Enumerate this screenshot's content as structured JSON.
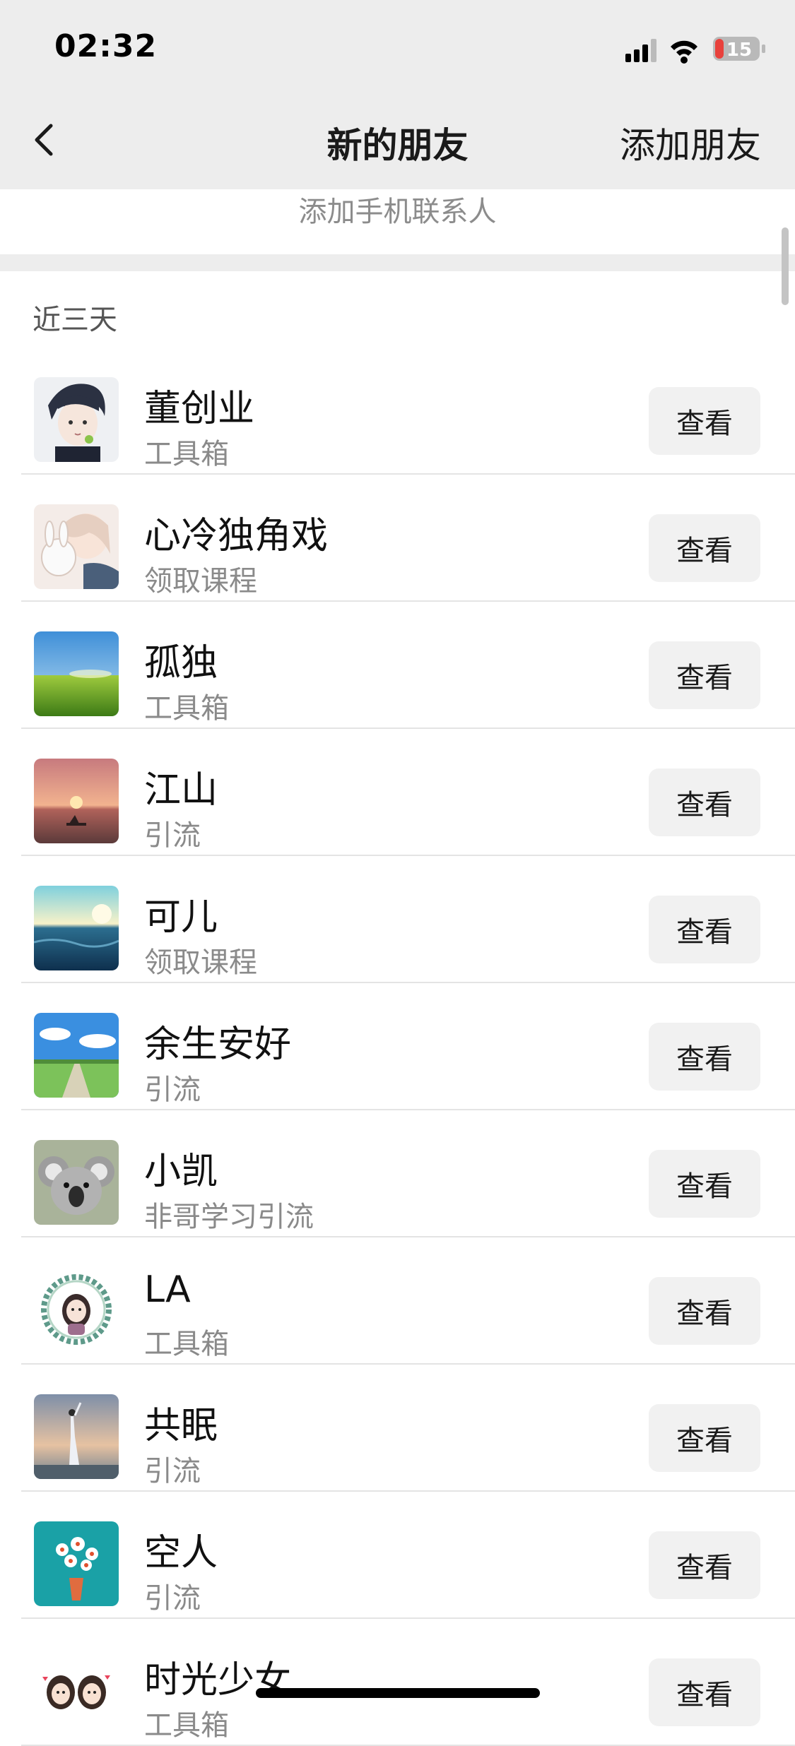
{
  "status_bar": {
    "time": "02:32",
    "battery": "15",
    "icons": [
      "signal-icon",
      "wifi-icon",
      "battery-icon"
    ]
  },
  "nav": {
    "back_icon": "chevron-left-icon",
    "title": "新的朋友",
    "add_friend": "添加朋友"
  },
  "phone_contacts": "添加手机联系人",
  "section_title": "近三天",
  "view_label": "查看",
  "friends": [
    {
      "name": "董创业",
      "source": "工具箱",
      "avatar": "anime-boy-avatar"
    },
    {
      "name": "心冷独角戏",
      "source": "领取课程",
      "avatar": "anime-girl-bunny-avatar"
    },
    {
      "name": "孤独",
      "source": "工具箱",
      "avatar": "grass-field-sky-avatar"
    },
    {
      "name": "江山",
      "source": "引流",
      "avatar": "sunset-boat-avatar"
    },
    {
      "name": "可儿",
      "source": "领取课程",
      "avatar": "ocean-sunlight-avatar"
    },
    {
      "name": "余生安好",
      "source": "引流",
      "avatar": "countryside-clouds-avatar"
    },
    {
      "name": "小凯",
      "source": "非哥学习引流",
      "avatar": "koala-avatar"
    },
    {
      "name": "LA",
      "source": "工具箱",
      "avatar": "girl-wreath-avatar"
    },
    {
      "name": "共眠",
      "source": "引流",
      "avatar": "person-sunset-avatar"
    },
    {
      "name": "空人",
      "source": "引流",
      "avatar": "flower-bouquet-avatar"
    },
    {
      "name": "时光少女",
      "source": "工具箱",
      "avatar": "two-girls-cartoon-avatar"
    }
  ]
}
